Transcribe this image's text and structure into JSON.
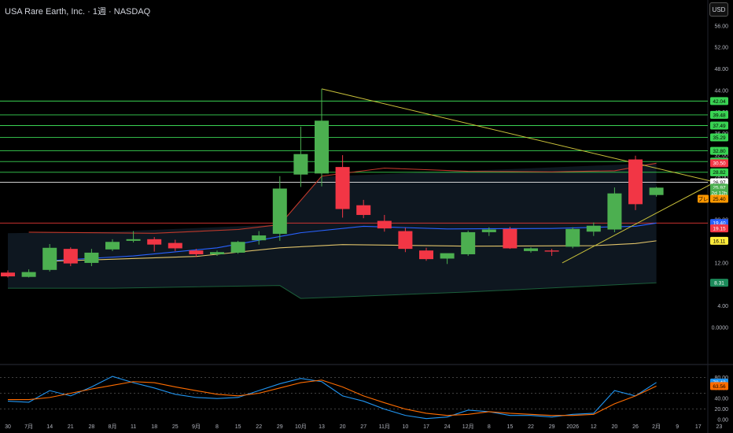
{
  "header": {
    "title": "USA Rare Earth, Inc. · 1週 · NASDAQ",
    "currency_button": "USD"
  },
  "colors": {
    "bull": "#4caf50",
    "bear": "#f23645",
    "hline": "#39d353",
    "trend": "#c9c13a",
    "ma_red": "#c0392b",
    "ma_blue": "#2962ff",
    "ma_yellow": "#e0c36a",
    "band": "#1b5e3a",
    "osc_blue": "#2196f3",
    "osc_orange": "#ff6d00"
  },
  "chart_data": [
    {
      "type": "candlestick",
      "ylim": [
        -3.5,
        57
      ],
      "y_ticks": [
        "56.00",
        "52.00",
        "48.00",
        "44.00",
        "40.00",
        "36.00",
        "32.00",
        "28.00",
        "24.00",
        "20.00",
        "16.00",
        "12.00",
        "8.00",
        "4.00",
        "0.0000"
      ],
      "x_tick_labels": [
        "30",
        "7月",
        "14",
        "21",
        "28",
        "8月",
        "11",
        "18",
        "25",
        "9月",
        "8",
        "15",
        "22",
        "29",
        "10月",
        "13",
        "20",
        "27",
        "11月",
        "10",
        "17",
        "24",
        "12月",
        "8",
        "15",
        "22",
        "29",
        "2026",
        "12",
        "20",
        "26",
        "2月",
        "9",
        "17",
        "23"
      ],
      "candles": [
        {
          "o": 10.2,
          "h": 10.6,
          "l": 9.3,
          "c": 9.5
        },
        {
          "o": 9.4,
          "h": 10.8,
          "l": 9.3,
          "c": 10.3
        },
        {
          "o": 10.7,
          "h": 15.5,
          "l": 10.4,
          "c": 14.8
        },
        {
          "o": 14.6,
          "h": 14.9,
          "l": 11.4,
          "c": 11.9
        },
        {
          "o": 12.0,
          "h": 14.6,
          "l": 11.4,
          "c": 13.9
        },
        {
          "o": 14.5,
          "h": 16.4,
          "l": 14.2,
          "c": 15.9
        },
        {
          "o": 16.1,
          "h": 17.9,
          "l": 15.8,
          "c": 16.4
        },
        {
          "o": 16.4,
          "h": 16.8,
          "l": 14.1,
          "c": 15.4
        },
        {
          "o": 15.7,
          "h": 16.3,
          "l": 14.2,
          "c": 14.7
        },
        {
          "o": 14.3,
          "h": 14.6,
          "l": 13.1,
          "c": 13.6
        },
        {
          "o": 13.6,
          "h": 14.3,
          "l": 13.3,
          "c": 14.0
        },
        {
          "o": 13.9,
          "h": 16.1,
          "l": 13.7,
          "c": 15.9
        },
        {
          "o": 16.2,
          "h": 17.9,
          "l": 15.4,
          "c": 17.1
        },
        {
          "o": 17.4,
          "h": 28.1,
          "l": 16.1,
          "c": 25.8
        },
        {
          "o": 28.4,
          "h": 37.3,
          "l": 26.1,
          "c": 32.2
        },
        {
          "o": 28.6,
          "h": 44.3,
          "l": 26.2,
          "c": 38.4
        },
        {
          "o": 29.8,
          "h": 32.0,
          "l": 20.4,
          "c": 22.0
        },
        {
          "o": 22.7,
          "h": 23.7,
          "l": 20.3,
          "c": 20.9
        },
        {
          "o": 19.8,
          "h": 20.9,
          "l": 17.8,
          "c": 18.4
        },
        {
          "o": 17.9,
          "h": 18.5,
          "l": 14.0,
          "c": 14.6
        },
        {
          "o": 14.3,
          "h": 14.8,
          "l": 12.4,
          "c": 12.7
        },
        {
          "o": 12.8,
          "h": 13.6,
          "l": 11.8,
          "c": 13.8
        },
        {
          "o": 13.6,
          "h": 18.0,
          "l": 13.3,
          "c": 17.7
        },
        {
          "o": 17.7,
          "h": 18.6,
          "l": 17.0,
          "c": 18.2
        },
        {
          "o": 18.3,
          "h": 18.7,
          "l": 14.6,
          "c": 14.7
        },
        {
          "o": 14.2,
          "h": 14.9,
          "l": 13.9,
          "c": 14.7
        },
        {
          "o": 14.3,
          "h": 14.6,
          "l": 13.3,
          "c": 14.1
        },
        {
          "o": 15.0,
          "h": 18.6,
          "l": 14.7,
          "c": 18.3
        },
        {
          "o": 17.8,
          "h": 19.5,
          "l": 17.0,
          "c": 18.9
        },
        {
          "o": 18.2,
          "h": 26.0,
          "l": 17.7,
          "c": 24.9
        },
        {
          "o": 31.2,
          "h": 31.9,
          "l": 21.8,
          "c": 22.9
        },
        {
          "o": 24.6,
          "h": 26.1,
          "l": 24.3,
          "c": 25.97
        }
      ],
      "ma_red": [
        [
          1,
          17.7
        ],
        [
          7,
          17.5
        ],
        [
          11,
          18.2
        ],
        [
          13,
          19.1
        ],
        [
          15,
          28.1
        ],
        [
          18,
          29.6
        ],
        [
          22,
          29.0
        ],
        [
          26,
          28.9
        ],
        [
          29,
          29.1
        ],
        [
          31,
          30.5
        ]
      ],
      "ma_blue": [
        [
          2,
          12.4
        ],
        [
          6,
          13.3
        ],
        [
          10,
          14.8
        ],
        [
          14,
          17.6
        ],
        [
          17,
          18.8
        ],
        [
          21,
          18.3
        ],
        [
          26,
          18.4
        ],
        [
          30,
          18.8
        ],
        [
          31,
          19.4
        ]
      ],
      "ma_yellow": [
        [
          2,
          12.3
        ],
        [
          9,
          13.2
        ],
        [
          13,
          14.8
        ],
        [
          16,
          15.4
        ],
        [
          22,
          15.1
        ],
        [
          28,
          15.2
        ],
        [
          30,
          15.6
        ],
        [
          31,
          16.1
        ]
      ],
      "band_upper": [
        [
          0,
          17.5
        ],
        [
          5,
          17.8
        ],
        [
          13,
          19.1
        ],
        [
          15,
          28.0
        ],
        [
          31,
          30.5
        ]
      ],
      "band_lower": [
        [
          0,
          7.3
        ],
        [
          5,
          7.3
        ],
        [
          13,
          7.8
        ],
        [
          14,
          5.4
        ],
        [
          22,
          6.6
        ],
        [
          31,
          8.3
        ]
      ],
      "trendline_upper": [
        [
          15,
          44.3
        ],
        [
          33.8,
          27.0
        ]
      ],
      "trendline_lower": [
        [
          26.5,
          12.0
        ],
        [
          33.8,
          27.0
        ]
      ],
      "hlines": [
        42.04,
        39.48,
        37.49,
        35.29,
        32.8,
        30.81,
        28.82,
        26.97
      ],
      "hline_red": 19.4,
      "price_tags": [
        {
          "value": "42.04",
          "y": 42.04,
          "bg": "#39d353",
          "fg": "#000"
        },
        {
          "value": "39.48",
          "y": 39.48,
          "bg": "#39d353",
          "fg": "#000"
        },
        {
          "value": "37.49",
          "y": 37.49,
          "bg": "#39d353",
          "fg": "#000"
        },
        {
          "value": "35.29",
          "y": 35.29,
          "bg": "#39d353",
          "fg": "#000"
        },
        {
          "value": "32.80",
          "y": 32.8,
          "bg": "#39d353",
          "fg": "#000"
        },
        {
          "value": "30.81",
          "y": 30.81,
          "bg": "#39d353",
          "fg": "#000"
        },
        {
          "value": "30.50",
          "y": 30.5,
          "bg": "#f23645",
          "fg": "#fff"
        },
        {
          "value": "28.82",
          "y": 28.82,
          "bg": "#39d353",
          "fg": "#000"
        },
        {
          "value": "26.97",
          "y": 26.97,
          "bg": "#ffffff",
          "fg": "#000"
        },
        {
          "value": "25.97",
          "y": 25.97,
          "bg": "#4caf50",
          "fg": "#fff"
        },
        {
          "value": "2d 12h",
          "y": 25.0,
          "bg": "#4caf50",
          "fg": "#fff"
        },
        {
          "value": "25.40",
          "y": 23.9,
          "bg": "#ff9800",
          "fg": "#000"
        },
        {
          "value": "19.40",
          "y": 19.4,
          "bg": "#2962ff",
          "fg": "#fff"
        },
        {
          "value": "19.15",
          "y": 18.4,
          "bg": "#f23645",
          "fg": "#fff"
        },
        {
          "value": "16.11",
          "y": 16.1,
          "bg": "#ffeb3b",
          "fg": "#000"
        },
        {
          "value": "8.31",
          "y": 8.31,
          "bg": "#1b8a5a",
          "fg": "#fff"
        }
      ],
      "left_tag": "プレ"
    },
    {
      "type": "line",
      "ylim": [
        0,
        100
      ],
      "y_ticks": [
        "80.00",
        "60.00",
        "40.00",
        "20.00",
        "0.00"
      ],
      "levels": [
        80,
        50,
        20
      ],
      "series": [
        {
          "color": "#2196f3",
          "values": [
            [
              0,
              35
            ],
            [
              1,
              33
            ],
            [
              2,
              55
            ],
            [
              3,
              45
            ],
            [
              4,
              62
            ],
            [
              5,
              82
            ],
            [
              6,
              70
            ],
            [
              7,
              60
            ],
            [
              8,
              48
            ],
            [
              9,
              42
            ],
            [
              10,
              40
            ],
            [
              11,
              42
            ],
            [
              12,
              55
            ],
            [
              13,
              68
            ],
            [
              14,
              78
            ],
            [
              15,
              72
            ],
            [
              16,
              45
            ],
            [
              17,
              35
            ],
            [
              18,
              20
            ],
            [
              19,
              8
            ],
            [
              20,
              2
            ],
            [
              21,
              5
            ],
            [
              22,
              18
            ],
            [
              23,
              15
            ],
            [
              24,
              8
            ],
            [
              25,
              8
            ],
            [
              26,
              5
            ],
            [
              27,
              10
            ],
            [
              28,
              12
            ],
            [
              29,
              55
            ],
            [
              30,
              45
            ],
            [
              31,
              70.42
            ]
          ]
        },
        {
          "color": "#ff6d00",
          "values": [
            [
              0,
              38
            ],
            [
              1,
              38
            ],
            [
              2,
              42
            ],
            [
              3,
              50
            ],
            [
              4,
              58
            ],
            [
              5,
              65
            ],
            [
              6,
              72
            ],
            [
              7,
              70
            ],
            [
              8,
              62
            ],
            [
              9,
              55
            ],
            [
              10,
              48
            ],
            [
              11,
              45
            ],
            [
              12,
              50
            ],
            [
              13,
              60
            ],
            [
              14,
              70
            ],
            [
              15,
              75
            ],
            [
              16,
              62
            ],
            [
              17,
              45
            ],
            [
              18,
              32
            ],
            [
              19,
              20
            ],
            [
              20,
              12
            ],
            [
              21,
              8
            ],
            [
              22,
              10
            ],
            [
              23,
              15
            ],
            [
              24,
              12
            ],
            [
              25,
              10
            ],
            [
              26,
              8
            ],
            [
              27,
              8
            ],
            [
              28,
              10
            ],
            [
              29,
              30
            ],
            [
              30,
              45
            ],
            [
              31,
              63.56
            ]
          ]
        }
      ],
      "tags": [
        {
          "value": "70.42",
          "y": 70.42,
          "bg": "#2196f3",
          "fg": "#fff"
        },
        {
          "value": "63.56",
          "y": 63.56,
          "bg": "#ff6d00",
          "fg": "#000"
        }
      ]
    }
  ]
}
